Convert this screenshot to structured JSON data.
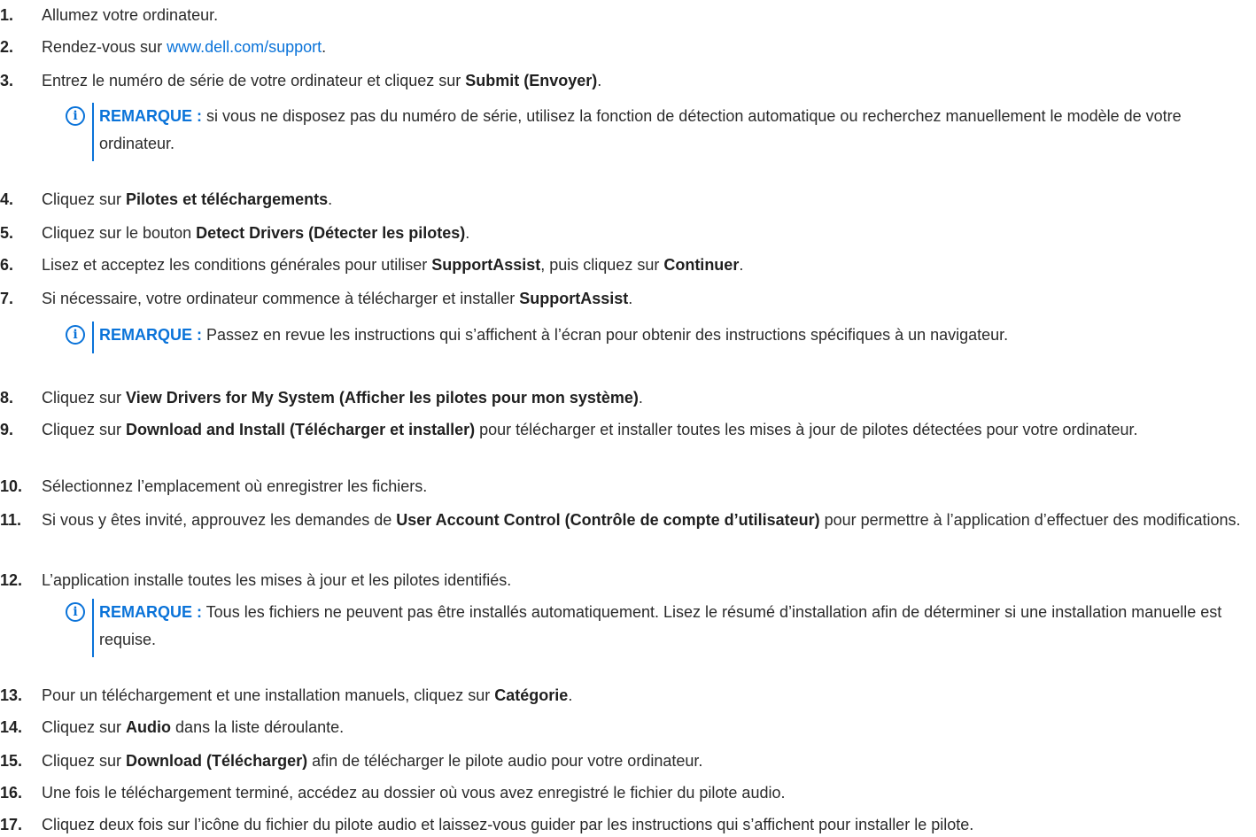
{
  "steps": [
    {
      "num": "1.",
      "parts": [
        {
          "t": "Allumez votre ordinateur."
        }
      ]
    },
    {
      "num": "2.",
      "parts": [
        {
          "t": "Rendez-vous sur "
        },
        {
          "t": "www.dell.com/support",
          "link": true
        },
        {
          "t": "."
        }
      ]
    },
    {
      "num": "3.",
      "parts": [
        {
          "t": "Entrez le numéro de série de votre ordinateur et cliquez sur "
        },
        {
          "t": "Submit (Envoyer)",
          "b": true
        },
        {
          "t": "."
        }
      ]
    },
    {
      "num": "4.",
      "parts": [
        {
          "t": "Cliquez sur "
        },
        {
          "t": "Pilotes et téléchargements",
          "b": true
        },
        {
          "t": "."
        }
      ]
    },
    {
      "num": "5.",
      "parts": [
        {
          "t": "Cliquez sur le bouton "
        },
        {
          "t": "Detect Drivers (Détecter les pilotes)",
          "b": true
        },
        {
          "t": "."
        }
      ]
    },
    {
      "num": "6.",
      "parts": [
        {
          "t": "Lisez et acceptez les conditions générales pour utiliser "
        },
        {
          "t": "SupportAssist",
          "b": true
        },
        {
          "t": ", puis cliquez sur "
        },
        {
          "t": "Continuer",
          "b": true
        },
        {
          "t": "."
        }
      ]
    },
    {
      "num": "7.",
      "parts": [
        {
          "t": "Si nécessaire, votre ordinateur commence à télécharger et installer "
        },
        {
          "t": "SupportAssist",
          "b": true
        },
        {
          "t": "."
        }
      ]
    },
    {
      "num": "8.",
      "parts": [
        {
          "t": "Cliquez sur "
        },
        {
          "t": "View Drivers for My System (Afficher les pilotes pour mon système)",
          "b": true
        },
        {
          "t": "."
        }
      ]
    },
    {
      "num": "9.",
      "parts": [
        {
          "t": "Cliquez sur "
        },
        {
          "t": "Download and Install (Télécharger et installer)",
          "b": true
        },
        {
          "t": " pour télécharger et installer toutes les mises à jour de pilotes détectées pour votre ordinateur."
        }
      ]
    },
    {
      "num": "10.",
      "parts": [
        {
          "t": "Sélectionnez l’emplacement où enregistrer les fichiers."
        }
      ]
    },
    {
      "num": "11.",
      "parts": [
        {
          "t": "Si vous y êtes invité, approuvez les demandes de "
        },
        {
          "t": "User Account Control (Contrôle de compte d’utilisateur)",
          "b": true
        },
        {
          "t": " pour permettre à l’application d’effectuer des modifications."
        }
      ]
    },
    {
      "num": "12.",
      "parts": [
        {
          "t": "L’application installe toutes les mises à jour et les pilotes identifiés."
        }
      ]
    },
    {
      "num": "13.",
      "parts": [
        {
          "t": "Pour un téléchargement et une installation manuels, cliquez sur "
        },
        {
          "t": "Catégorie",
          "b": true
        },
        {
          "t": "."
        }
      ]
    },
    {
      "num": "14.",
      "parts": [
        {
          "t": "Cliquez sur "
        },
        {
          "t": "Audio",
          "b": true
        },
        {
          "t": " dans la liste déroulante."
        }
      ]
    },
    {
      "num": "15.",
      "parts": [
        {
          "t": "Cliquez sur "
        },
        {
          "t": "Download (Télécharger)",
          "b": true
        },
        {
          "t": " afin de télécharger le pilote audio pour votre ordinateur."
        }
      ]
    },
    {
      "num": "16.",
      "parts": [
        {
          "t": "Une fois le téléchargement terminé, accédez au dossier où vous avez enregistré le fichier du pilote audio."
        }
      ]
    },
    {
      "num": "17.",
      "parts": [
        {
          "t": "Cliquez deux fois sur l’icône du fichier du pilote audio et laissez-vous guider par les instructions qui s’affichent pour installer le pilote."
        }
      ]
    }
  ],
  "notes": [
    {
      "label": "REMARQUE :",
      "text": " si vous ne disposez pas du numéro de série, utilisez la fonction de détection automatique ou recherchez manuellement le modèle de votre ordinateur."
    },
    {
      "label": "REMARQUE :",
      "text": " Passez en revue les instructions qui s’affichent à l’écran pour obtenir des instructions spécifiques à un navigateur."
    },
    {
      "label": "REMARQUE :",
      "text": " Tous les fichiers ne peuvent pas être installés automatiquement. Lisez le résumé d’installation afin de déterminer si une installation manuelle est requise."
    }
  ],
  "info_glyph": "i",
  "colors": {
    "accent": "#0a73d9",
    "text": "#2b2b2b"
  }
}
